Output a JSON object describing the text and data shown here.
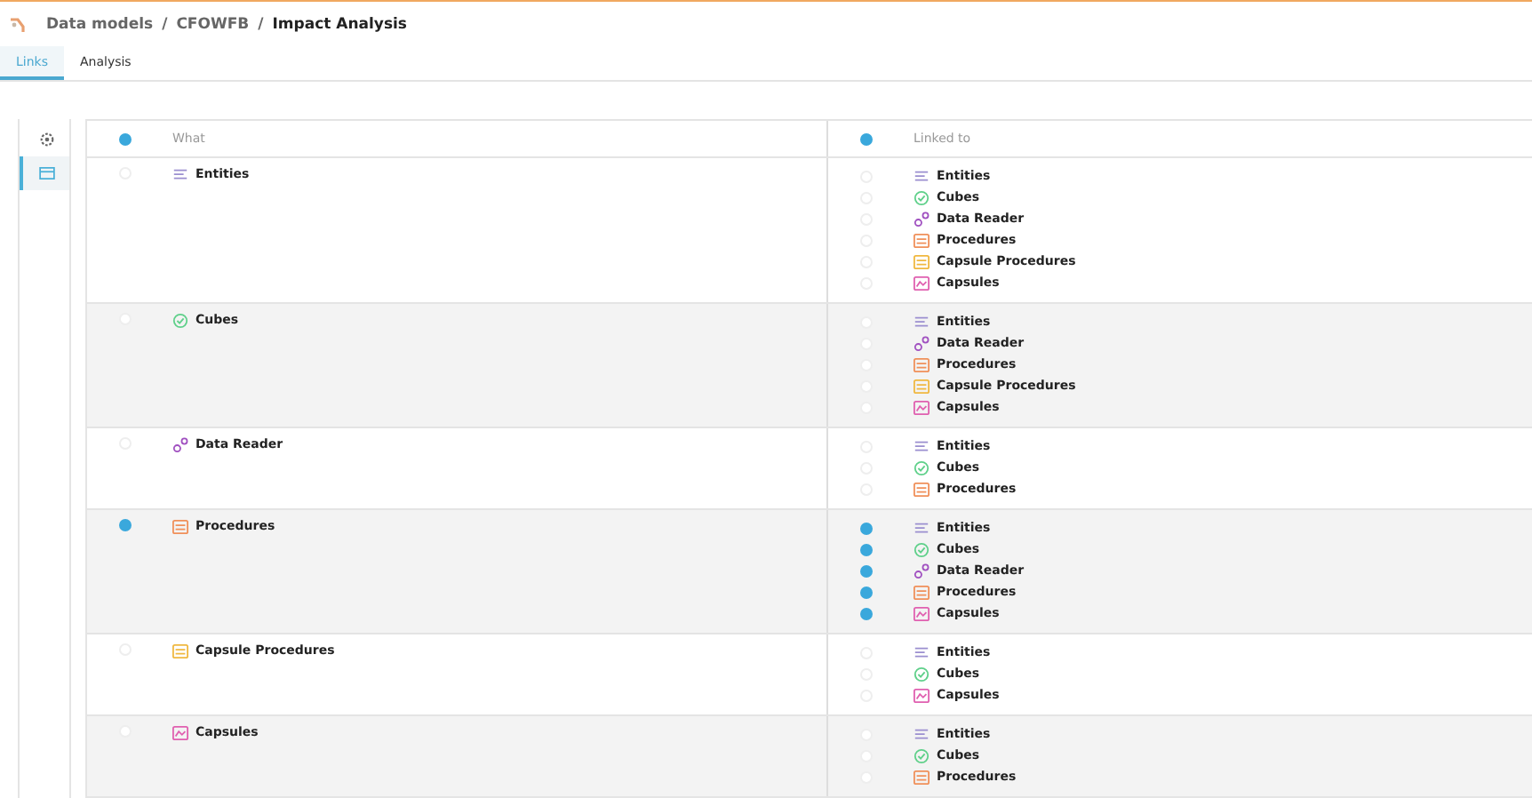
{
  "breadcrumb_separator": "/",
  "breadcrumb": [
    {
      "label": "Data models",
      "current": false
    },
    {
      "label": "CFOWFB",
      "current": false
    },
    {
      "label": "Impact Analysis",
      "current": true
    }
  ],
  "tabs": [
    {
      "label": "Links",
      "selected": true
    },
    {
      "label": "Analysis",
      "selected": false
    }
  ],
  "sidebar": {
    "items": [
      {
        "kind": "gear",
        "selected": false
      },
      {
        "kind": "table",
        "selected": true
      }
    ]
  },
  "table": {
    "columns": [
      {
        "label": "What",
        "checked": true
      },
      {
        "label": "Linked to",
        "checked": true
      }
    ],
    "rows": [
      {
        "label": "Entities",
        "kind": "entity",
        "checked": false,
        "links": [
          {
            "label": "Entities",
            "kind": "entity",
            "checked": false
          },
          {
            "label": "Cubes",
            "kind": "cube",
            "checked": false
          },
          {
            "label": "Data Reader",
            "kind": "reader",
            "checked": false
          },
          {
            "label": "Procedures",
            "kind": "procedure",
            "checked": false
          },
          {
            "label": "Capsule Procedures",
            "kind": "capsule-procedure",
            "checked": false
          },
          {
            "label": "Capsules",
            "kind": "capsule",
            "checked": false
          }
        ]
      },
      {
        "label": "Cubes",
        "kind": "cube",
        "checked": false,
        "links": [
          {
            "label": "Entities",
            "kind": "entity",
            "checked": false
          },
          {
            "label": "Data Reader",
            "kind": "reader",
            "checked": false
          },
          {
            "label": "Procedures",
            "kind": "procedure",
            "checked": false
          },
          {
            "label": "Capsule Procedures",
            "kind": "capsule-procedure",
            "checked": false
          },
          {
            "label": "Capsules",
            "kind": "capsule",
            "checked": false
          }
        ]
      },
      {
        "label": "Data Reader",
        "kind": "reader",
        "checked": false,
        "links": [
          {
            "label": "Entities",
            "kind": "entity",
            "checked": false
          },
          {
            "label": "Cubes",
            "kind": "cube",
            "checked": false
          },
          {
            "label": "Procedures",
            "kind": "procedure",
            "checked": false
          }
        ]
      },
      {
        "label": "Procedures",
        "kind": "procedure",
        "checked": true,
        "links": [
          {
            "label": "Entities",
            "kind": "entity",
            "checked": true
          },
          {
            "label": "Cubes",
            "kind": "cube",
            "checked": true
          },
          {
            "label": "Data Reader",
            "kind": "reader",
            "checked": true
          },
          {
            "label": "Procedures",
            "kind": "procedure",
            "checked": true
          },
          {
            "label": "Capsules",
            "kind": "capsule",
            "checked": true
          }
        ]
      },
      {
        "label": "Capsule Procedures",
        "kind": "capsule-procedure",
        "checked": false,
        "links": [
          {
            "label": "Entities",
            "kind": "entity",
            "checked": false
          },
          {
            "label": "Cubes",
            "kind": "cube",
            "checked": false
          },
          {
            "label": "Capsules",
            "kind": "capsule",
            "checked": false
          }
        ]
      },
      {
        "label": "Capsules",
        "kind": "capsule",
        "checked": false,
        "links": [
          {
            "label": "Entities",
            "kind": "entity",
            "checked": false
          },
          {
            "label": "Cubes",
            "kind": "cube",
            "checked": false
          },
          {
            "label": "Procedures",
            "kind": "procedure",
            "checked": false
          }
        ]
      }
    ]
  }
}
